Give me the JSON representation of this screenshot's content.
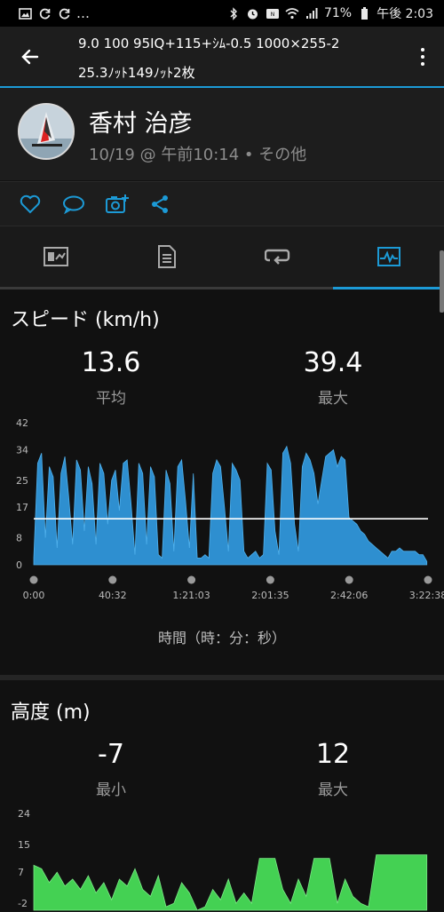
{
  "status_bar": {
    "left_icons": [
      "image-icon",
      "sync-icon",
      "sync-icon",
      "more-dots-icon"
    ],
    "battery": "71%",
    "time": "午後 2:03"
  },
  "app_bar": {
    "title_line1": "9.0 100 95IQ+115+ｼﾑ-0.5 1000×255-2",
    "title_line2": "25.3ﾉｯﾄ149ﾉｯﾄ2枚"
  },
  "profile": {
    "name": "香村 治彦",
    "meta": "10/19 @ 午前10:14 • その他"
  },
  "actions": [
    "like-icon",
    "comment-icon",
    "add-photo-icon",
    "share-icon"
  ],
  "tabs": [
    {
      "name": "summary",
      "icon": "chart-card-icon",
      "active": false
    },
    {
      "name": "details",
      "icon": "document-icon",
      "active": false
    },
    {
      "name": "laps",
      "icon": "loop-icon",
      "active": false
    },
    {
      "name": "graphs",
      "icon": "graph-icon",
      "active": true
    }
  ],
  "speed": {
    "title": "スピード (km/h)",
    "avg_value": "13.6",
    "avg_label": "平均",
    "max_value": "39.4",
    "max_label": "最大",
    "x_axis_label": "時間（時：分：秒）"
  },
  "altitude": {
    "title": "高度 (m)",
    "min_value": "-7",
    "min_label": "最小",
    "max_value": "12",
    "max_label": "最大"
  },
  "colors": {
    "accent": "#1c9ad6",
    "speed_fill": "#2e8fd0",
    "altitude_fill": "#44d153",
    "avg_line": "#ffffff"
  },
  "chart_data": [
    {
      "type": "area",
      "title": "スピード (km/h)",
      "xlabel": "時間（時：分：秒）",
      "ylabel": "",
      "x_ticks": [
        "0:00",
        "40:32",
        "1:21:03",
        "2:01:35",
        "2:42:06",
        "3:22:38"
      ],
      "y_ticks": [
        0,
        8,
        17,
        25,
        34,
        42
      ],
      "ylim": [
        0,
        42
      ],
      "x_minutes_range": [
        0,
        202.6
      ],
      "average_line": 13.6,
      "series": [
        {
          "x_minutes": [
            0,
            2,
            4,
            6,
            8,
            10,
            12,
            14,
            16,
            18,
            20,
            22,
            24,
            26,
            28,
            30,
            32,
            34,
            36,
            38,
            40,
            42,
            44,
            46,
            48,
            50,
            52,
            54,
            56,
            58,
            60,
            62,
            64,
            66,
            68,
            70,
            72,
            74,
            76,
            78,
            80,
            82,
            84,
            86,
            88,
            90,
            92,
            94,
            96,
            98,
            100,
            102,
            104,
            106,
            108,
            110,
            112,
            114,
            116,
            118,
            120,
            122,
            124,
            126,
            128,
            130,
            132,
            134,
            136,
            138,
            140,
            142,
            144,
            146,
            148,
            150,
            152,
            154,
            156,
            158,
            160,
            162,
            164,
            166,
            168,
            170,
            172,
            174,
            176,
            178,
            180,
            182,
            184,
            186,
            188,
            190,
            192,
            194,
            196,
            198,
            200,
            202
          ],
          "values": [
            2,
            30,
            33,
            8,
            29,
            26,
            5,
            27,
            32,
            20,
            6,
            31,
            28,
            10,
            29,
            24,
            6,
            30,
            27,
            12,
            25,
            28,
            16,
            30,
            31,
            18,
            3,
            30,
            27,
            6,
            29,
            26,
            3,
            2,
            28,
            24,
            4,
            29,
            31,
            19,
            5,
            27,
            2,
            2,
            3,
            2,
            27,
            31,
            29,
            17,
            4,
            30,
            28,
            25,
            4,
            2,
            3,
            4,
            2,
            3,
            30,
            28,
            10,
            3,
            33,
            35,
            30,
            12,
            4,
            29,
            33,
            31,
            27,
            18,
            25,
            32,
            33,
            34,
            29,
            32,
            31,
            14,
            13,
            12,
            10,
            9,
            7,
            6,
            5,
            4,
            3,
            2,
            4,
            4,
            5,
            4,
            4,
            4,
            4,
            3,
            3,
            1
          ]
        }
      ]
    },
    {
      "type": "area",
      "title": "高度 (m)",
      "xlabel": "時間（時：分：秒）",
      "ylabel": "",
      "y_ticks": [
        24,
        15,
        7,
        -2
      ],
      "ylim": [
        -4,
        24
      ],
      "x_minutes_range": [
        0,
        202.6
      ],
      "series": [
        {
          "x_minutes": [
            0,
            4,
            8,
            12,
            16,
            20,
            24,
            28,
            32,
            36,
            40,
            44,
            48,
            52,
            56,
            60,
            64,
            68,
            72,
            76,
            80,
            84,
            88,
            92,
            96,
            100,
            104,
            108,
            112,
            116,
            120,
            124,
            128,
            132,
            136,
            140,
            144,
            148,
            152,
            156,
            160,
            164,
            168,
            172,
            176,
            180,
            184,
            188,
            192,
            196,
            200,
            202
          ],
          "values": [
            9,
            8,
            4,
            7,
            3,
            5,
            2,
            6,
            1,
            4,
            -1,
            5,
            3,
            8,
            2,
            0,
            6,
            -3,
            -2,
            4,
            1,
            -4,
            -3,
            2,
            -1,
            5,
            -2,
            1,
            -2,
            11,
            11,
            11,
            2,
            -2,
            5,
            0,
            11,
            11,
            11,
            -2,
            5,
            0,
            -2,
            -3,
            12,
            12,
            12,
            12,
            12,
            12,
            12,
            12
          ]
        }
      ]
    }
  ]
}
